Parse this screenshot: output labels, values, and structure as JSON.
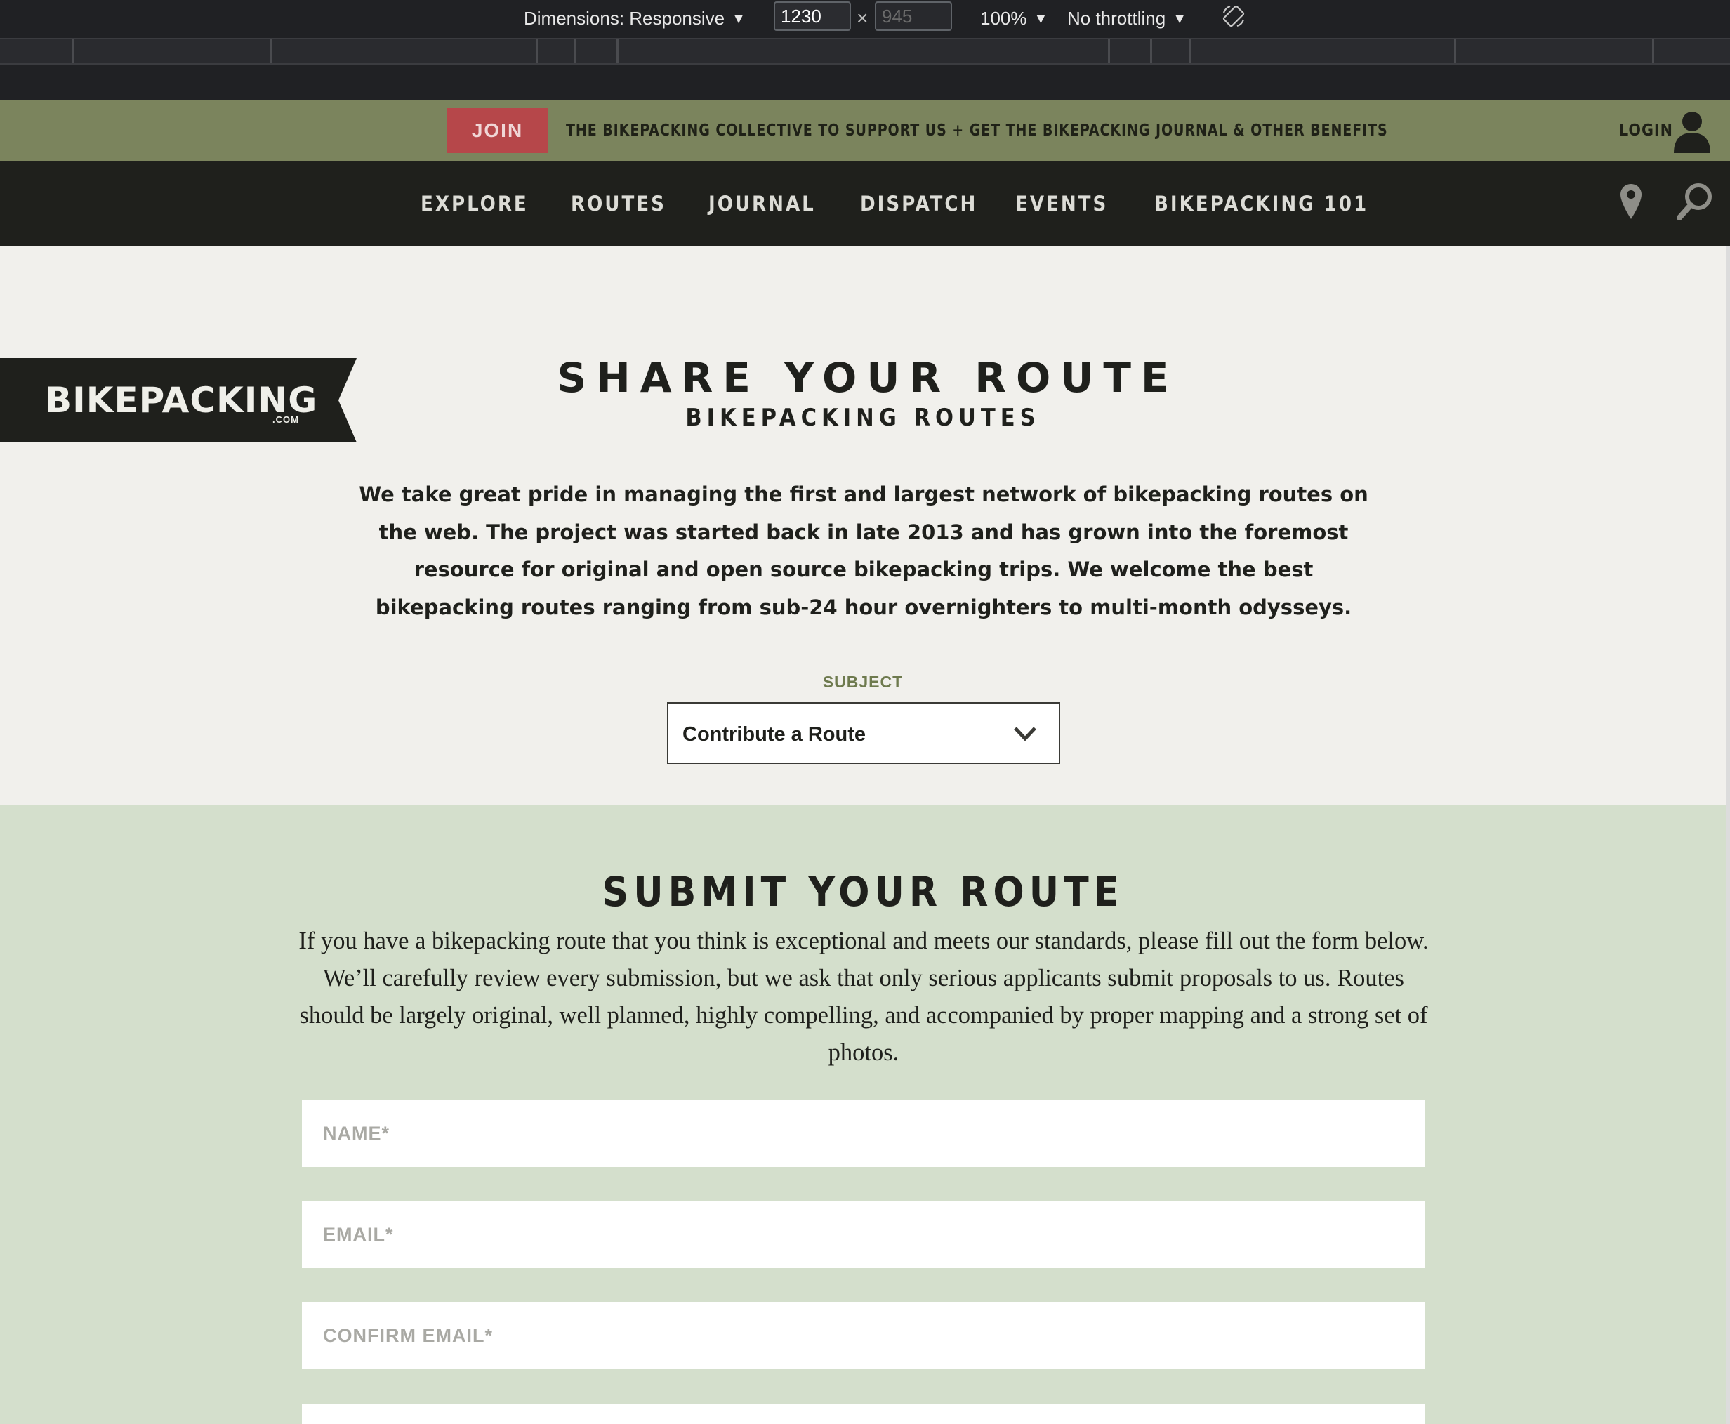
{
  "devtools": {
    "dimensions_label": "Dimensions: Responsive",
    "width_value": "1230",
    "height_value": "945",
    "times": "×",
    "zoom": "100%",
    "throttling": "No throttling",
    "caret": "▼"
  },
  "joinbar": {
    "join_label": "JOIN",
    "message": "THE BIKEPACKING COLLECTIVE TO SUPPORT US + GET THE BIKEPACKING JOURNAL & OTHER BENEFITS",
    "login_label": "LOGIN"
  },
  "nav": {
    "items": [
      "EXPLORE",
      "ROUTES",
      "JOURNAL",
      "DISPATCH",
      "EVENTS",
      "BIKEPACKING 101"
    ]
  },
  "logo": {
    "text": "BIKEPACKING",
    "suffix": ".COM"
  },
  "hero": {
    "title": "SHARE YOUR ROUTE",
    "subtitle": "BIKEPACKING ROUTES",
    "description": "We take great pride in managing the first and largest network of bikepacking routes on the web. The project was started back in late 2013 and has grown into the foremost resource for original and open source bikepacking trips. We welcome the best bikepacking routes ranging from sub-24 hour overnighters to multi-month odysseys.",
    "subject_label": "SUBJECT",
    "subject_value": "Contribute a Route"
  },
  "form": {
    "title": "SUBMIT YOUR ROUTE",
    "description": "If you have a bikepacking route that you think is exceptional and meets our standards, please fill out the form below. We’ll carefully review every submission, but we ask that only serious applicants submit proposals to us. Routes should be largely original, well planned, highly compelling, and accompanied by proper mapping and a strong set of photos.",
    "name_placeholder": "NAME*",
    "email_placeholder": "EMAIL*",
    "confirm_email_placeholder": "CONFIRM EMAIL*"
  },
  "colors": {
    "devtools_bg": "#202124",
    "joinbar_bg": "#7b845d",
    "join_button": "#b6474a",
    "nav_bg": "#1f201c",
    "hero_bg": "#f1f0ec",
    "form_bg": "#d4dfcc",
    "accent_label": "#6e7a4e"
  },
  "icons": [
    "chevron-down-icon",
    "rotate-icon",
    "user-icon",
    "map-pin-icon",
    "search-icon"
  ]
}
